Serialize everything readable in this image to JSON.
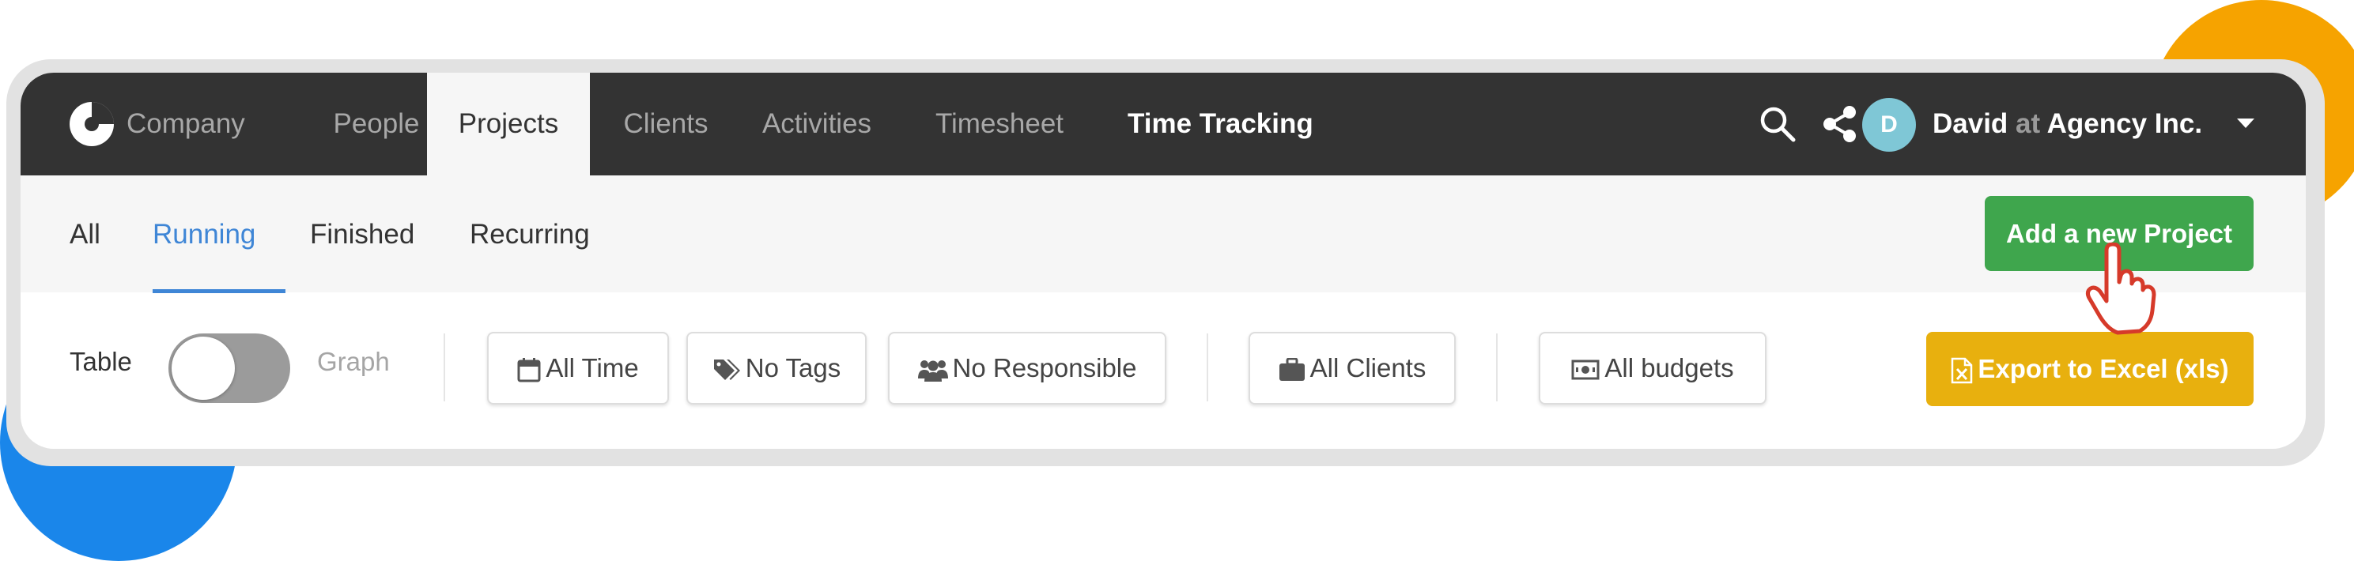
{
  "nav": {
    "items": [
      {
        "label": "Company"
      },
      {
        "label": "People"
      },
      {
        "label": "Projects"
      },
      {
        "label": "Clients"
      },
      {
        "label": "Activities"
      },
      {
        "label": "Timesheet"
      },
      {
        "label": "Time Tracking"
      }
    ],
    "active": "Projects",
    "user": {
      "avatar_letter": "D",
      "name": "David",
      "at": "at",
      "company": "Agency Inc."
    }
  },
  "tabs": {
    "items": [
      {
        "label": "All"
      },
      {
        "label": "Running"
      },
      {
        "label": "Finished"
      },
      {
        "label": "Recurring"
      }
    ],
    "active": "Running"
  },
  "actions": {
    "add_project_label": "Add a new Project",
    "export_label": "Export to Excel (xls)"
  },
  "view_toggle": {
    "left_label": "Table",
    "right_label": "Graph",
    "selected": "Table"
  },
  "filters": {
    "time": "All Time",
    "tags": "No Tags",
    "responsible": "No Responsible",
    "clients": "All Clients",
    "budgets": "All budgets"
  },
  "icons": [
    "company-logo-icon",
    "search-icon",
    "share-icon",
    "caret-down-icon",
    "calendar-icon",
    "tags-icon",
    "users-icon",
    "briefcase-icon",
    "money-icon",
    "excel-file-icon",
    "hand-pointer-icon"
  ],
  "colors": {
    "nav_bg": "#333333",
    "accent_blue": "#3f86d6",
    "add_button": "#3fa64d",
    "export_button": "#e8b00e",
    "avatar": "#7fc7d6",
    "deco_orange": "#f6a300",
    "deco_blue": "#1a86ea"
  }
}
